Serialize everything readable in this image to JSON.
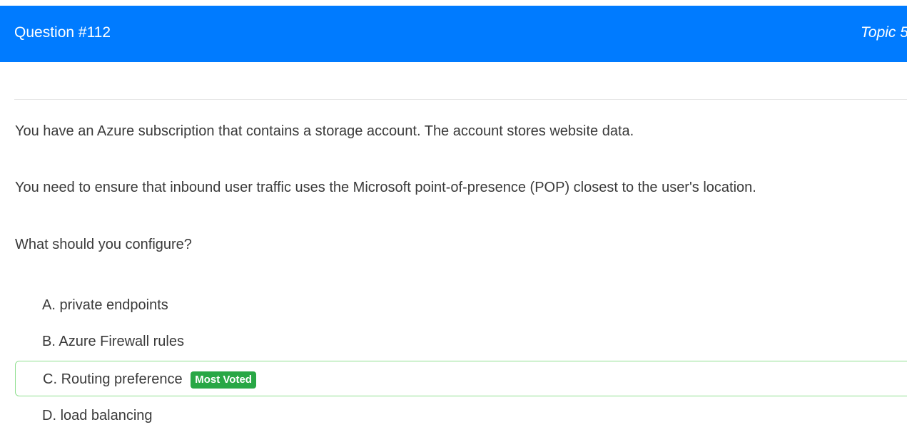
{
  "header": {
    "question_label": "Question #112",
    "topic_label": "Topic 5"
  },
  "question": {
    "paragraphs": [
      "You have an Azure subscription that contains a storage account. The account stores website data.",
      "You need to ensure that inbound user traffic uses the Microsoft point-of-presence (POP) closest to the user's location.",
      "What should you configure?"
    ]
  },
  "choices": [
    {
      "letter": "A.",
      "text": "private endpoints"
    },
    {
      "letter": "B.",
      "text": "Azure Firewall rules"
    },
    {
      "letter": "C.",
      "text": "Routing preference",
      "badge": "Most Voted"
    },
    {
      "letter": "D.",
      "text": "load balancing"
    }
  ],
  "colors": {
    "header_bg": "#007bff",
    "badge_bg": "#28a745",
    "highlight_border": "#8fdf8f"
  }
}
